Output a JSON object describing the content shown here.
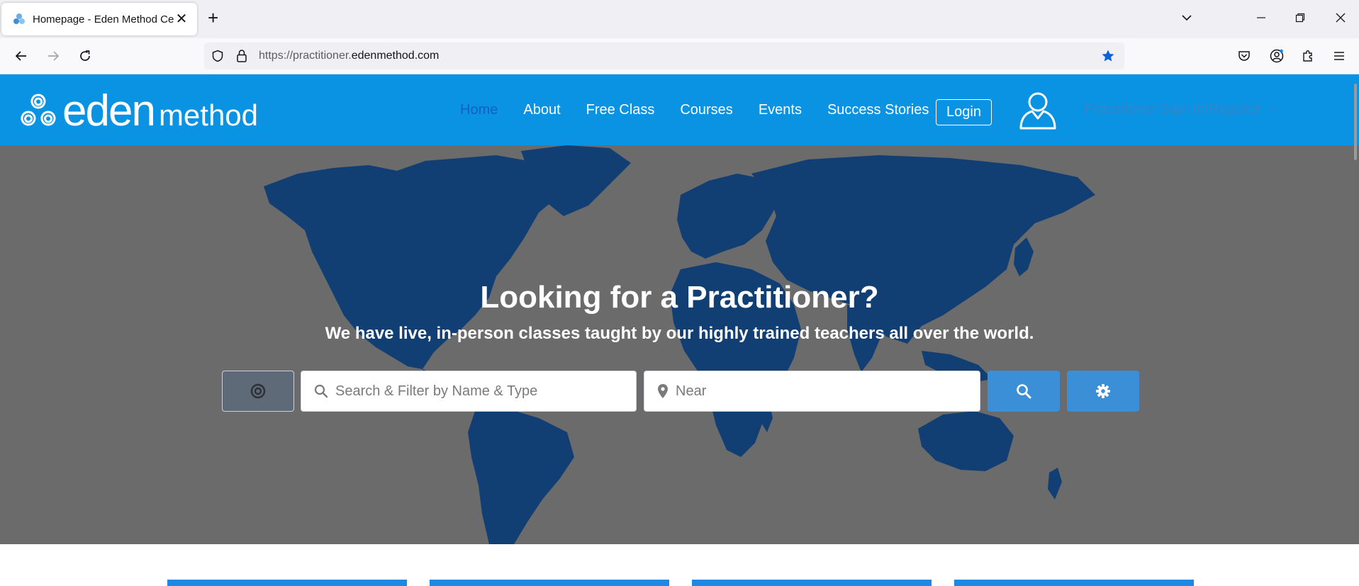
{
  "browser": {
    "tab_title": "Homepage - Eden Method Cer",
    "url_prefix": "https://practitioner.",
    "url_host": "edenmethod.com"
  },
  "header": {
    "logo_word1": "eden",
    "logo_word2": "method",
    "menu": [
      {
        "label": "Home",
        "active": true
      },
      {
        "label": "About"
      },
      {
        "label": "Free Class"
      },
      {
        "label": "Courses"
      },
      {
        "label": "Events"
      },
      {
        "label": "Success Stories"
      }
    ],
    "login_label": "Login",
    "practitioner_label": "Practitioner Sign In/Register →"
  },
  "hero": {
    "title": "Looking for a Practitioner?",
    "subtitle": "We have live, in-person classes taught by our highly trained teachers all over the world.",
    "search_placeholder": "Search & Filter by Name & Type",
    "near_placeholder": "Near"
  },
  "colors": {
    "header_blue": "#0993e2",
    "active_link": "#1260c6",
    "button_blue": "#3a8fd6",
    "map_blue": "#123f73",
    "hero_gray": "#6b6b6b"
  },
  "icons": [
    "eden-logo-icon",
    "user-icon",
    "locate-icon",
    "search-icon",
    "map-pin-icon",
    "gear-icon"
  ]
}
